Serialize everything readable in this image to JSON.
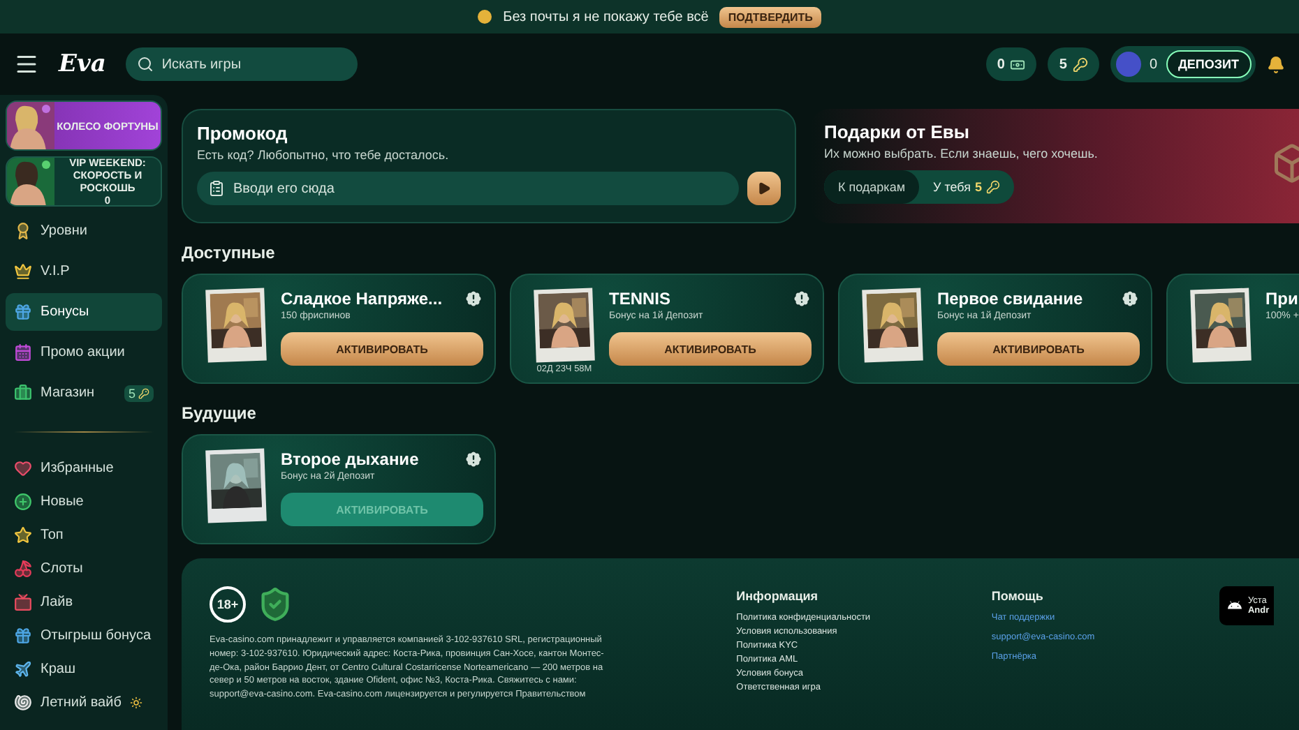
{
  "notice": {
    "text": "Без почты я не покажу тебе всё",
    "button": "ПОДТВЕРДИТЬ"
  },
  "header": {
    "logo": "Eva",
    "search_placeholder": "Искать игры",
    "balances": [
      {
        "kind": "cash",
        "value": "0"
      },
      {
        "kind": "keys",
        "value": "5"
      }
    ],
    "wallet": {
      "amount": "0",
      "button": "ДЕПОЗИТ"
    }
  },
  "sidebar": {
    "promos": [
      {
        "kind": "fortune",
        "label": "КОЛЕСО ФОРТУНЫ"
      },
      {
        "kind": "vip",
        "label": "VIP WEEKEND: СКОРОСТЬ И РОСКОШЬ",
        "count": "0"
      }
    ],
    "menu": [
      {
        "kind": "medal",
        "label": "Уровни",
        "selected": false
      },
      {
        "kind": "crown",
        "label": "V.I.P",
        "selected": false
      },
      {
        "kind": "gift",
        "label": "Бонусы",
        "selected": true
      },
      {
        "kind": "calendar",
        "label": "Промо акции",
        "selected": false
      },
      {
        "kind": "shop",
        "label": "Магазин",
        "selected": false,
        "badge": "5"
      }
    ],
    "games": [
      {
        "kind": "heart",
        "label": "Избранные",
        "selected": false
      },
      {
        "kind": "plus",
        "label": "Новые",
        "selected": false
      },
      {
        "kind": "star",
        "label": "Топ",
        "selected": false
      },
      {
        "kind": "cherry",
        "label": "Слоты",
        "selected": false
      },
      {
        "kind": "live",
        "label": "Лайв",
        "selected": false
      },
      {
        "kind": "gift",
        "label": "Отыгрыш бонуса",
        "selected": false
      },
      {
        "kind": "plane",
        "label": "Краш",
        "selected": false
      },
      {
        "kind": "shell",
        "label": "Летний вайб",
        "selected": false
      }
    ]
  },
  "promo": {
    "title": "Промокод",
    "subtitle": "Есть код? Любопытно, что тебе досталось.",
    "placeholder": "Вводи его сюда"
  },
  "gifts": {
    "title": "Подарки от Евы",
    "subtitle": "Их можно выбрать. Если знаешь, чего хочешь.",
    "button": "К подаркам",
    "keys_label": "У тебя",
    "keys_count": "5"
  },
  "sections": [
    {
      "title": "Доступные",
      "cards": [
        {
          "title": "Сладкое Напряже...",
          "subtitle": "150 фриспинов",
          "button": "АКТИВИРОВАТЬ",
          "disabled": false
        },
        {
          "title": "TENNIS",
          "subtitle": "Бонус на 1й Депозит",
          "button": "АКТИВИРОВАТЬ",
          "timer": "02Д 23Ч 58М",
          "disabled": false
        },
        {
          "title": "Первое свидание",
          "subtitle": "Бонус на 1й Депозит",
          "button": "АКТИВИРОВАТЬ",
          "disabled": false
        },
        {
          "title": "При",
          "subtitle": "100% +",
          "disabled": false
        }
      ]
    },
    {
      "title": "Будущие",
      "cards": [
        {
          "title": "Второе дыхание",
          "subtitle": "Бонус на 2й Депозит",
          "button": "АКТИВИРОВАТЬ",
          "disabled": true
        }
      ]
    }
  ],
  "footer": {
    "age": "18+",
    "text": "Eva-casino.com принадлежит и управляется компанией 3-102-937610 SRL, регистрационный номер: 3-102-937610. Юридический адрес: Коста-Рика, провинция Сан-Хосе, кантон Монтес-де-Ока, район Баррио Дент, от Centro Cultural Costarricense Norteamericano — 200 метров на север и 50 метров на восток, здание Ofident, офис №3, Коста-Рика. Свяжитесь с нами: support@eva-casino.com. Eva-casino.com лицензируется и регулируется Правительством",
    "columns": [
      {
        "title": "Информация",
        "kind": "plain",
        "links": [
          "Политика конфиденциальности",
          "Условия использования",
          "Политика KYC",
          "Политика AML",
          "Условия бонуса",
          "Ответственная игра"
        ]
      },
      {
        "title": "Помощь",
        "kind": "link",
        "links": [
          "Чат поддержки",
          "support@eva-casino.com",
          "Партнёрка"
        ]
      }
    ],
    "app": {
      "line1": "Уста",
      "line2": "Andr"
    }
  }
}
